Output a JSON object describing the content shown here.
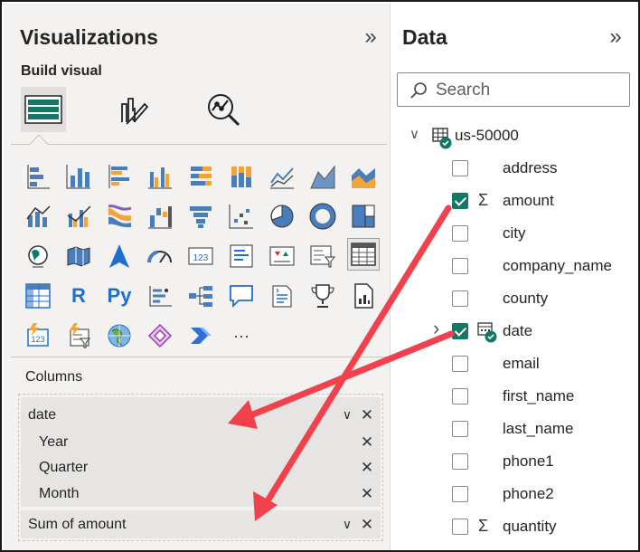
{
  "visualizations": {
    "title": "Visualizations",
    "build_visual_label": "Build visual",
    "more_label": "···",
    "columns_label": "Columns",
    "field_well": {
      "date_field": "date",
      "hierarchy": [
        "Year",
        "Quarter",
        "Month"
      ],
      "measure_field": "Sum of amount"
    }
  },
  "data_pane": {
    "title": "Data",
    "search_placeholder": "Search",
    "table_name": "us-50000",
    "fields": [
      {
        "name": "address",
        "checked": false,
        "sigma": false
      },
      {
        "name": "amount",
        "checked": true,
        "sigma": true
      },
      {
        "name": "city",
        "checked": false,
        "sigma": false
      },
      {
        "name": "company_name",
        "checked": false,
        "sigma": false
      },
      {
        "name": "county",
        "checked": false,
        "sigma": false
      },
      {
        "name": "date",
        "checked": true,
        "sigma": false,
        "expandable": true
      },
      {
        "name": "email",
        "checked": false,
        "sigma": false
      },
      {
        "name": "first_name",
        "checked": false,
        "sigma": false
      },
      {
        "name": "last_name",
        "checked": false,
        "sigma": false
      },
      {
        "name": "phone1",
        "checked": false,
        "sigma": false
      },
      {
        "name": "phone2",
        "checked": false,
        "sigma": false
      },
      {
        "name": "quantity",
        "checked": false,
        "sigma": true
      }
    ]
  },
  "colors": {
    "accent_green": "#117865",
    "annotation_red": "#f0414d",
    "pane_bg": "#f3f2f1"
  }
}
